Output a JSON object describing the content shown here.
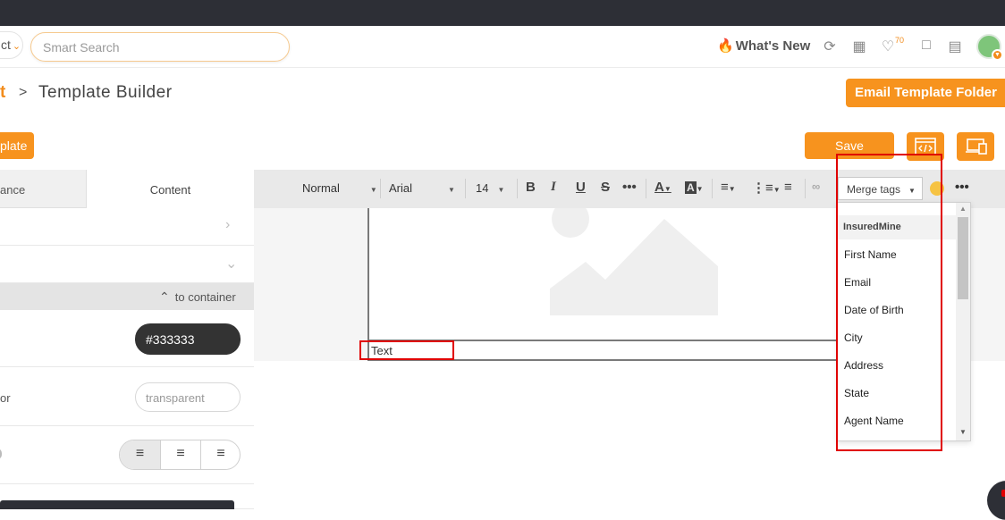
{
  "header": {
    "select_label": "ct",
    "search_placeholder": "Smart Search",
    "whats_new_label": "What's New",
    "notification_count": "70"
  },
  "breadcrumb": {
    "previous": "t",
    "separator": ">",
    "current": "Template Builder"
  },
  "actions": {
    "email_template_folder": "Email Template Folder",
    "template_button": "plate",
    "save": "Save"
  },
  "left_panel": {
    "tabs": [
      "ance",
      "Content"
    ],
    "collapse_label": "to container",
    "text_color_value": "#333333",
    "background_label": "or",
    "background_value": "transparent"
  },
  "toolbar": {
    "format": "Normal",
    "font": "Arial",
    "size": "14",
    "merge_tags": "Merge tags"
  },
  "canvas": {
    "text_block": "Text"
  },
  "merge_dropdown": {
    "group": "InsuredMine",
    "items": [
      "First Name",
      "Email",
      "Date of Birth",
      "City",
      "Address",
      "State",
      "Agent Name"
    ]
  }
}
